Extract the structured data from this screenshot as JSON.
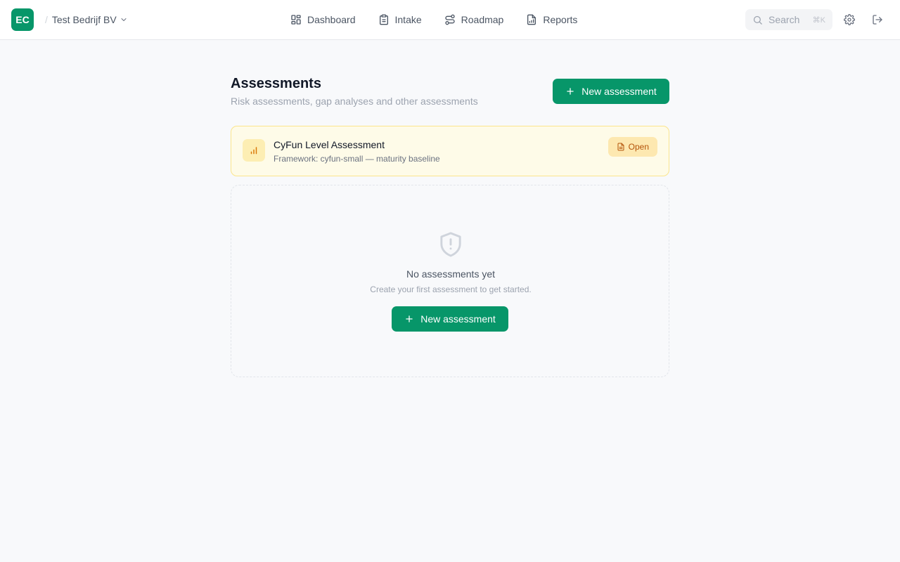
{
  "header": {
    "logo": "EC",
    "org_separator": "/",
    "org_name": "Test Bedrijf BV",
    "nav": [
      {
        "label": "Dashboard",
        "icon": "dashboard-grid-icon"
      },
      {
        "label": "Intake",
        "icon": "clipboard-icon"
      },
      {
        "label": "Roadmap",
        "icon": "route-icon"
      },
      {
        "label": "Reports",
        "icon": "report-file-icon"
      }
    ],
    "search_label": "Search",
    "search_shortcut": "⌘K"
  },
  "page": {
    "title": "Assessments",
    "subtitle": "Risk assessments, gap analyses and other assessments",
    "new_button": "New assessment"
  },
  "assessment": {
    "name": "CyFun Level Assessment",
    "framework": "Framework: cyfun-small — maturity baseline",
    "status": "Open"
  },
  "empty_state": {
    "title": "No assessments yet",
    "subtitle": "Create your first assessment to get started.",
    "button": "New assessment"
  },
  "colors": {
    "brand": "#079669",
    "card_bg": "#fefbe8",
    "badge_text": "#b45309"
  }
}
